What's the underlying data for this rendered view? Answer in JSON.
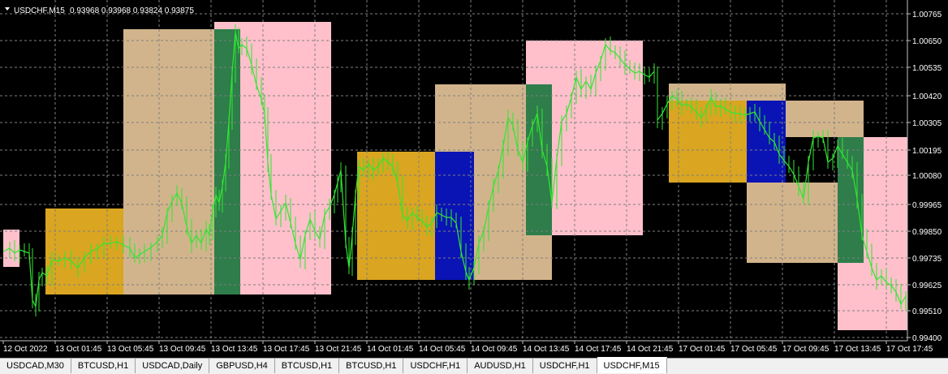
{
  "header": {
    "symbol": "USDCHF,M15",
    "ohlc": "0.93968 0.93968 0.93824 0.93875"
  },
  "colors": {
    "background": "#000000",
    "grid": "#7f7f7f",
    "candle_line": "#32e632",
    "zone_orange": "#daa520",
    "zone_tan": "#d2b48c",
    "zone_blue": "#0a14b4",
    "zone_green": "#2e7d4a",
    "zone_pink": "#ffc0cb"
  },
  "price_axis": [
    "1.00765",
    "1.00650",
    "1.00535",
    "1.00420",
    "1.00305",
    "1.00195",
    "1.00080",
    "0.99965",
    "0.99850",
    "0.99735",
    "0.99625",
    "0.99510",
    "0.99400"
  ],
  "time_axis": [
    "12 Oct 2022",
    "13 Oct 01:45",
    "13 Oct 05:45",
    "13 Oct 09:45",
    "13 Oct 13:45",
    "13 Oct 17:45",
    "13 Oct 21:45",
    "14 Oct 01:45",
    "14 Oct 05:45",
    "14 Oct 09:45",
    "14 Oct 13:45",
    "14 Oct 17:45",
    "14 Oct 21:45",
    "17 Oct 01:45",
    "17 Oct 05:45",
    "17 Oct 09:45",
    "17 Oct 13:45",
    "17 Oct 17:45"
  ],
  "tabs": [
    {
      "label": "USDCAD,M30",
      "active": false
    },
    {
      "label": "BTCUSD,H1",
      "active": false
    },
    {
      "label": "USDCAD,Daily",
      "active": false
    },
    {
      "label": "GBPUSD,H4",
      "active": false
    },
    {
      "label": "BTCUSD,H1",
      "active": false
    },
    {
      "label": "BTCUSD,H1",
      "active": false
    },
    {
      "label": "USDCHF,H1",
      "active": false
    },
    {
      "label": "AUDUSD,H1",
      "active": false
    },
    {
      "label": "USDCHF,H1",
      "active": false
    },
    {
      "label": "USDCHF,M15",
      "active": true
    }
  ]
}
